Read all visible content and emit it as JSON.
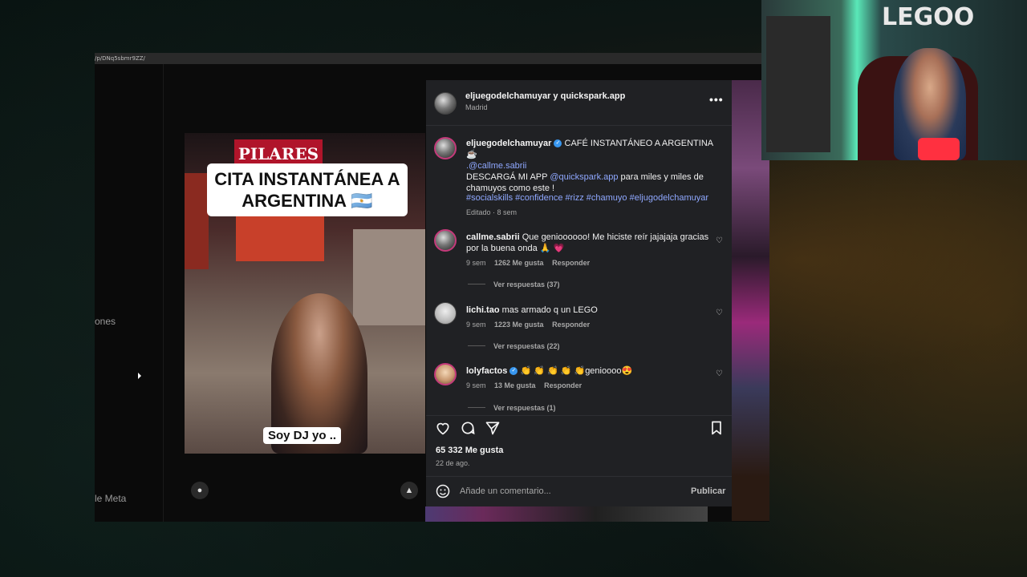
{
  "browser": {
    "url": "/p/DNq5sbmr9ZZ/",
    "left_text_1": "ones",
    "left_text_2": "le Meta"
  },
  "video": {
    "sign_text": "PILARES",
    "overlay_title": "CITA INSTANTÁNEA A ARGENTINA 🇦🇷",
    "caption": "Soy DJ yo .."
  },
  "post": {
    "header_title": "eljuegodelchamuyar y quickspark.app",
    "header_location": "Madrid",
    "more_icon": "more-horizontal-icon",
    "caption": {
      "username": "eljuegodelchamuyar",
      "line1": "CAFÉ INSTANTÁNEO A ARGENTINA ☕",
      "mention1": ".@callme.sabrii",
      "line2_pre": "DESCARGÁ MI APP ",
      "mention2": "@quickspark.app",
      "line2_post": " para miles y miles de",
      "line3": "chamuyos como este !",
      "hashtags": "#socialskills #confidence #rizz #chamuyo #eljugodelchamuyar",
      "meta": "Editado · 8 sem"
    },
    "comments": [
      {
        "username": "callme.sabrii",
        "text1": "Que genioooooo! Me hiciste reír jajajaja gracias",
        "text2": "por la buena onda 🙏 💗",
        "time": "9 sem",
        "likes": "1262 Me gusta",
        "reply": "Responder",
        "view_replies": "Ver respuestas (37)"
      },
      {
        "username": "lichi.tao",
        "text1": "mas armado q un LEGO",
        "time": "9 sem",
        "likes": "1223 Me gusta",
        "reply": "Responder",
        "view_replies": "Ver respuestas (22)"
      },
      {
        "username": "lolyfactos",
        "text1": "👏 👏 👏 👏 👏genioooo😍",
        "time": "9 sem",
        "likes": "13 Me gusta",
        "reply": "Responder",
        "view_replies": "Ver respuestas (1)"
      }
    ],
    "likes_count": "65 332 Me gusta",
    "date": "22 de ago.",
    "comment_placeholder": "Añade un comentario...",
    "publish_label": "Publicar"
  },
  "webcam": {
    "logo_text": "LEGOO"
  },
  "colors": {
    "panel_bg": "#202124",
    "link": "#8fa8ff",
    "verified": "#3897f0"
  }
}
